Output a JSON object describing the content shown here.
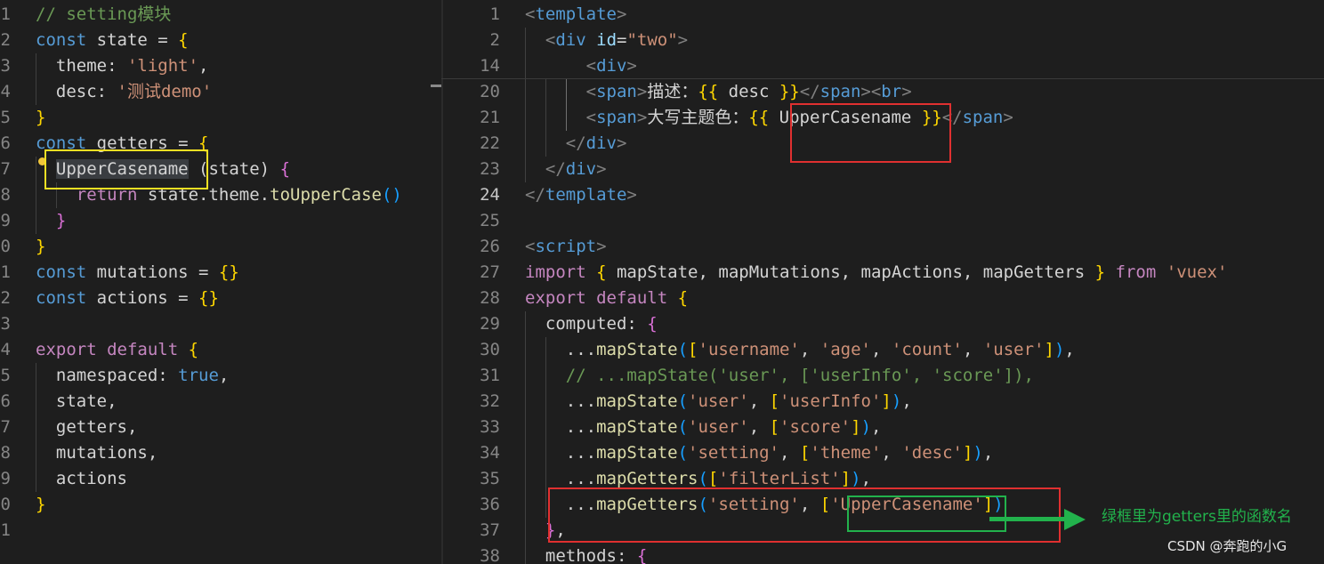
{
  "left_editor": {
    "lines": [
      {
        "n": "1",
        "tokens": [
          [
            "cm",
            "// setting模块"
          ]
        ]
      },
      {
        "n": "2",
        "tokens": [
          [
            "kw",
            "const"
          ],
          [
            "txt",
            " state = "
          ],
          [
            "p1",
            "{"
          ]
        ]
      },
      {
        "n": "3",
        "tokens": [
          [
            "txt",
            "  theme: "
          ],
          [
            "str",
            "'light'"
          ],
          [
            "txt",
            ","
          ]
        ]
      },
      {
        "n": "4",
        "tokens": [
          [
            "txt",
            "  desc: "
          ],
          [
            "str",
            "'测试demo'"
          ]
        ]
      },
      {
        "n": "5",
        "tokens": [
          [
            "p1",
            "}"
          ]
        ]
      },
      {
        "n": "6",
        "tokens": [
          [
            "kw",
            "const"
          ],
          [
            "txt",
            " getters = "
          ],
          [
            "p1",
            "{"
          ]
        ]
      },
      {
        "n": "7",
        "tokens": [
          [
            "txt",
            "  "
          ],
          [
            "hl",
            "UpperCasename"
          ],
          [
            "txt",
            " (state) "
          ],
          [
            "p2",
            "{"
          ]
        ]
      },
      {
        "n": "8",
        "tokens": [
          [
            "txt",
            "    "
          ],
          [
            "kw2",
            "return"
          ],
          [
            "txt",
            " state.theme."
          ],
          [
            "fn",
            "toUpperCase"
          ],
          [
            "p3",
            "()"
          ]
        ]
      },
      {
        "n": "9",
        "tokens": [
          [
            "txt",
            "  "
          ],
          [
            "p2",
            "}"
          ]
        ]
      },
      {
        "n": "0",
        "tokens": [
          [
            "p1",
            "}"
          ]
        ]
      },
      {
        "n": "1",
        "tokens": [
          [
            "kw",
            "const"
          ],
          [
            "txt",
            " mutations = "
          ],
          [
            "p1",
            "{}"
          ]
        ]
      },
      {
        "n": "2",
        "tokens": [
          [
            "kw",
            "const"
          ],
          [
            "txt",
            " actions = "
          ],
          [
            "p1",
            "{}"
          ]
        ]
      },
      {
        "n": "3",
        "tokens": []
      },
      {
        "n": "4",
        "tokens": [
          [
            "kw2",
            "export"
          ],
          [
            "txt",
            " "
          ],
          [
            "kw2",
            "default"
          ],
          [
            "txt",
            " "
          ],
          [
            "p1",
            "{"
          ]
        ]
      },
      {
        "n": "5",
        "tokens": [
          [
            "txt",
            "  namespaced: "
          ],
          [
            "kw",
            "true"
          ],
          [
            "txt",
            ","
          ]
        ]
      },
      {
        "n": "6",
        "tokens": [
          [
            "txt",
            "  state,"
          ]
        ]
      },
      {
        "n": "7",
        "tokens": [
          [
            "txt",
            "  getters,"
          ]
        ]
      },
      {
        "n": "8",
        "tokens": [
          [
            "txt",
            "  mutations,"
          ]
        ]
      },
      {
        "n": "9",
        "tokens": [
          [
            "txt",
            "  actions"
          ]
        ]
      },
      {
        "n": "0",
        "tokens": [
          [
            "p1",
            "}"
          ]
        ]
      },
      {
        "n": "1",
        "tokens": []
      }
    ]
  },
  "right_editor": {
    "active_line": "24",
    "lines": [
      {
        "n": "1",
        "tokens": [
          [
            "tagp",
            "<"
          ],
          [
            "tag",
            "template"
          ],
          [
            "tagp",
            ">"
          ]
        ]
      },
      {
        "n": "2",
        "tokens": [
          [
            "txt",
            "  "
          ],
          [
            "tagp",
            "<"
          ],
          [
            "tag",
            "div"
          ],
          [
            "txt",
            " "
          ],
          [
            "attr",
            "id"
          ],
          [
            "txt",
            "="
          ],
          [
            "str",
            "\"two\""
          ],
          [
            "tagp",
            ">"
          ]
        ]
      },
      {
        "n": "14",
        "tokens": [
          [
            "txt",
            "      "
          ],
          [
            "tagp",
            "<"
          ],
          [
            "tag",
            "div"
          ],
          [
            "tagp",
            ">"
          ]
        ]
      },
      {
        "n": "20",
        "tokens": [
          [
            "txt",
            "      "
          ],
          [
            "tagp",
            "<"
          ],
          [
            "tag",
            "span"
          ],
          [
            "tagp",
            ">"
          ],
          [
            "txt",
            "描述："
          ],
          [
            "p1",
            "{{"
          ],
          [
            "txt",
            " desc "
          ],
          [
            "p1",
            "}}"
          ],
          [
            "tagp",
            "</"
          ],
          [
            "tag",
            "span"
          ],
          [
            "tagp",
            "><"
          ],
          [
            "tag",
            "br"
          ],
          [
            "tagp",
            ">"
          ]
        ]
      },
      {
        "n": "21",
        "tokens": [
          [
            "txt",
            "      "
          ],
          [
            "tagp",
            "<"
          ],
          [
            "tag",
            "span"
          ],
          [
            "tagp",
            ">"
          ],
          [
            "txt",
            "大写主题色："
          ],
          [
            "p1",
            "{{"
          ],
          [
            "txt",
            " UpperCasename "
          ],
          [
            "p1",
            "}}"
          ],
          [
            "tagp",
            "</"
          ],
          [
            "tag",
            "span"
          ],
          [
            "tagp",
            ">"
          ]
        ]
      },
      {
        "n": "22",
        "tokens": [
          [
            "txt",
            "    "
          ],
          [
            "tagp",
            "</"
          ],
          [
            "tag",
            "div"
          ],
          [
            "tagp",
            ">"
          ]
        ]
      },
      {
        "n": "23",
        "tokens": [
          [
            "txt",
            "  "
          ],
          [
            "tagp",
            "</"
          ],
          [
            "tag",
            "div"
          ],
          [
            "tagp",
            ">"
          ]
        ]
      },
      {
        "n": "24",
        "tokens": [
          [
            "tagp",
            "</"
          ],
          [
            "tag",
            "template"
          ],
          [
            "tagp",
            ">"
          ]
        ]
      },
      {
        "n": "25",
        "tokens": []
      },
      {
        "n": "26",
        "tokens": [
          [
            "tagp",
            "<"
          ],
          [
            "tag",
            "script"
          ],
          [
            "tagp",
            ">"
          ]
        ]
      },
      {
        "n": "27",
        "tokens": [
          [
            "kw2",
            "import"
          ],
          [
            "txt",
            " "
          ],
          [
            "p1",
            "{"
          ],
          [
            "txt",
            " mapState, mapMutations, mapActions, mapGetters "
          ],
          [
            "p1",
            "}"
          ],
          [
            "txt",
            " "
          ],
          [
            "kw2",
            "from"
          ],
          [
            "txt",
            " "
          ],
          [
            "str",
            "'vuex'"
          ]
        ]
      },
      {
        "n": "28",
        "tokens": [
          [
            "kw2",
            "export"
          ],
          [
            "txt",
            " "
          ],
          [
            "kw2",
            "default"
          ],
          [
            "txt",
            " "
          ],
          [
            "p1",
            "{"
          ]
        ]
      },
      {
        "n": "29",
        "tokens": [
          [
            "txt",
            "  computed: "
          ],
          [
            "p2",
            "{"
          ]
        ]
      },
      {
        "n": "30",
        "tokens": [
          [
            "txt",
            "    ..."
          ],
          [
            "fn",
            "mapState"
          ],
          [
            "p3",
            "("
          ],
          [
            "p1",
            "["
          ],
          [
            "str",
            "'username'"
          ],
          [
            "txt",
            ", "
          ],
          [
            "str",
            "'age'"
          ],
          [
            "txt",
            ", "
          ],
          [
            "str",
            "'count'"
          ],
          [
            "txt",
            ", "
          ],
          [
            "str",
            "'user'"
          ],
          [
            "p1",
            "]"
          ],
          [
            "p3",
            ")"
          ],
          [
            "txt",
            ","
          ]
        ]
      },
      {
        "n": "31",
        "tokens": [
          [
            "txt",
            "    "
          ],
          [
            "cm",
            "// ...mapState('user', ['userInfo', 'score']),"
          ]
        ]
      },
      {
        "n": "32",
        "tokens": [
          [
            "txt",
            "    ..."
          ],
          [
            "fn",
            "mapState"
          ],
          [
            "p3",
            "("
          ],
          [
            "str",
            "'user'"
          ],
          [
            "txt",
            ", "
          ],
          [
            "p1",
            "["
          ],
          [
            "str",
            "'userInfo'"
          ],
          [
            "p1",
            "]"
          ],
          [
            "p3",
            ")"
          ],
          [
            "txt",
            ","
          ]
        ]
      },
      {
        "n": "33",
        "tokens": [
          [
            "txt",
            "    ..."
          ],
          [
            "fn",
            "mapState"
          ],
          [
            "p3",
            "("
          ],
          [
            "str",
            "'user'"
          ],
          [
            "txt",
            ", "
          ],
          [
            "p1",
            "["
          ],
          [
            "str",
            "'score'"
          ],
          [
            "p1",
            "]"
          ],
          [
            "p3",
            ")"
          ],
          [
            "txt",
            ","
          ]
        ]
      },
      {
        "n": "34",
        "tokens": [
          [
            "txt",
            "    ..."
          ],
          [
            "fn",
            "mapState"
          ],
          [
            "p3",
            "("
          ],
          [
            "str",
            "'setting'"
          ],
          [
            "txt",
            ", "
          ],
          [
            "p1",
            "["
          ],
          [
            "str",
            "'theme'"
          ],
          [
            "txt",
            ", "
          ],
          [
            "str",
            "'desc'"
          ],
          [
            "p1",
            "]"
          ],
          [
            "p3",
            ")"
          ],
          [
            "txt",
            ","
          ]
        ]
      },
      {
        "n": "35",
        "tokens": [
          [
            "txt",
            "    ..."
          ],
          [
            "fn",
            "mapGetters"
          ],
          [
            "p3",
            "("
          ],
          [
            "p1",
            "["
          ],
          [
            "str",
            "'filterList'"
          ],
          [
            "p1",
            "]"
          ],
          [
            "p3",
            ")"
          ],
          [
            "txt",
            ","
          ]
        ]
      },
      {
        "n": "36",
        "tokens": [
          [
            "txt",
            "    ..."
          ],
          [
            "fn",
            "mapGetters"
          ],
          [
            "p3",
            "("
          ],
          [
            "str",
            "'setting'"
          ],
          [
            "txt",
            ", "
          ],
          [
            "p1",
            "["
          ],
          [
            "str",
            "'UpperCasename'"
          ],
          [
            "p1",
            "]"
          ],
          [
            "p3",
            ")"
          ]
        ]
      },
      {
        "n": "37",
        "tokens": [
          [
            "txt",
            "  "
          ],
          [
            "p2",
            "}"
          ],
          [
            "txt",
            ","
          ]
        ]
      },
      {
        "n": "38",
        "tokens": [
          [
            "txt",
            "  methods: "
          ],
          [
            "p2",
            "{"
          ]
        ]
      }
    ]
  },
  "annotation": {
    "text": "绿框里为getters里的函数名"
  },
  "watermark": {
    "text": "CSDN @奔跑的小G"
  },
  "colors": {
    "background": "#1e1e1e",
    "highlight_yellow": "#f5e023",
    "highlight_red": "#e03030",
    "highlight_green": "#22b24c"
  }
}
